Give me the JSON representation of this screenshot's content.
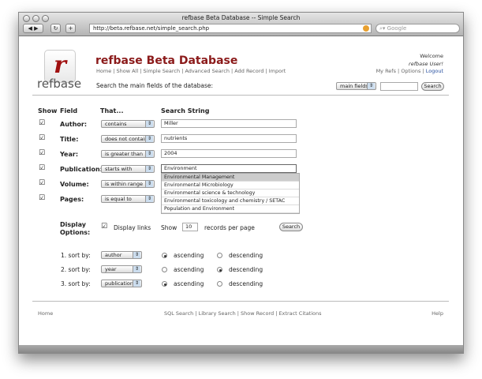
{
  "window": {
    "title": "refbase Beta Database -- Simple Search",
    "url": "http://beta.refbase.net/simple_search.php",
    "search_placeholder": "Google"
  },
  "header": {
    "logo_letter": "r",
    "logo_text": "refbase",
    "title": "refbase Beta Database",
    "nav": [
      "Home",
      "Show All",
      "Simple Search",
      "Advanced Search",
      "Add Record",
      "Import"
    ],
    "welcome": "Welcome",
    "user": "refbase User!",
    "user_links": [
      "My Refs",
      "Options",
      "Logout"
    ],
    "search_label": "Search the main fields of the database:",
    "field_select": "main fields",
    "search_button": "Search",
    "title_color": "#8b1a1a"
  },
  "form": {
    "headers": {
      "show": "Show",
      "field": "Field",
      "that": "That...",
      "string": "Search String"
    },
    "rows": [
      {
        "label": "Author:",
        "op": "contains",
        "value": "Miller"
      },
      {
        "label": "Title:",
        "op": "does not contain",
        "value": "nutrients"
      },
      {
        "label": "Year:",
        "op": "is greater than",
        "value": "2004"
      },
      {
        "label": "Publication:",
        "op": "starts with",
        "value": "Environment"
      },
      {
        "label": "Volume:",
        "op": "is within range",
        "value": ""
      },
      {
        "label": "Pages:",
        "op": "is equal to",
        "value": ""
      }
    ],
    "suggestions": [
      "Environmental Management",
      "Environmental Microbiology",
      "Environmental science & technology",
      "Environmental toxicology and chemistry / SETAC",
      "Population and Environment"
    ],
    "display": {
      "label1": "Display",
      "label2": "Options:",
      "links_label": "Display links",
      "show_label": "Show",
      "records": "10",
      "per_page": "records per page",
      "button": "Search"
    },
    "sort": [
      {
        "label": "1. sort by:",
        "field": "author",
        "order": "ascending"
      },
      {
        "label": "2. sort by:",
        "field": "year",
        "order": "descending"
      },
      {
        "label": "3. sort by:",
        "field": "publication",
        "order": "ascending"
      }
    ],
    "asc": "ascending",
    "desc": "descending"
  },
  "footer": {
    "home": "Home",
    "links": [
      "SQL Search",
      "Library Search",
      "Show Record",
      "Extract Citations"
    ],
    "help": "Help"
  }
}
